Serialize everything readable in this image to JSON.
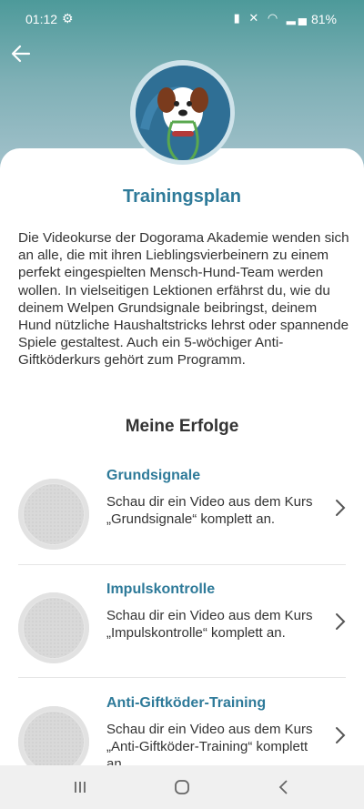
{
  "status_bar": {
    "time": "01:12",
    "battery": "81%"
  },
  "page": {
    "title": "Trainingsplan",
    "description": "Die Videokurse der Dogorama Akademie wenden sich an alle, die mit ihren Lieblingsvierbeinern zu einem perfekt eingespielten Mensch-Hund-Team werden wollen. In vielseitigen Lektionen erfährst du, wie du deinem Welpen Grundsignale beibringst, deinem Hund nützliche Haushaltstricks lehrst oder spannende Spiele gestaltest. Auch ein 5-wöchiger Anti-Giftköderkurs gehört zum Programm.",
    "section_title": "Meine Erfolge"
  },
  "achievements": [
    {
      "name": "Grundsignale",
      "text": "Schau dir ein Video aus dem Kurs „Grundsignale“ komplett an."
    },
    {
      "name": "Impulskontrolle",
      "text": "Schau dir ein Video aus dem Kurs „Impulskontrolle“ komplett an."
    },
    {
      "name": "Anti-Giftköder-Training",
      "text": "Schau dir ein Video aus dem Kurs „Anti-Giftköder-Training“ komplett an."
    }
  ],
  "icons": {
    "back": "arrow-left-icon",
    "settings": "gear-icon",
    "chevron": "chevron-right-icon",
    "nav_recent": "recent-apps-icon",
    "nav_home": "home-icon",
    "nav_back": "back-icon"
  },
  "colors": {
    "accent": "#2e7a99",
    "header_teal": "#4d9a9a",
    "text": "#333333"
  }
}
